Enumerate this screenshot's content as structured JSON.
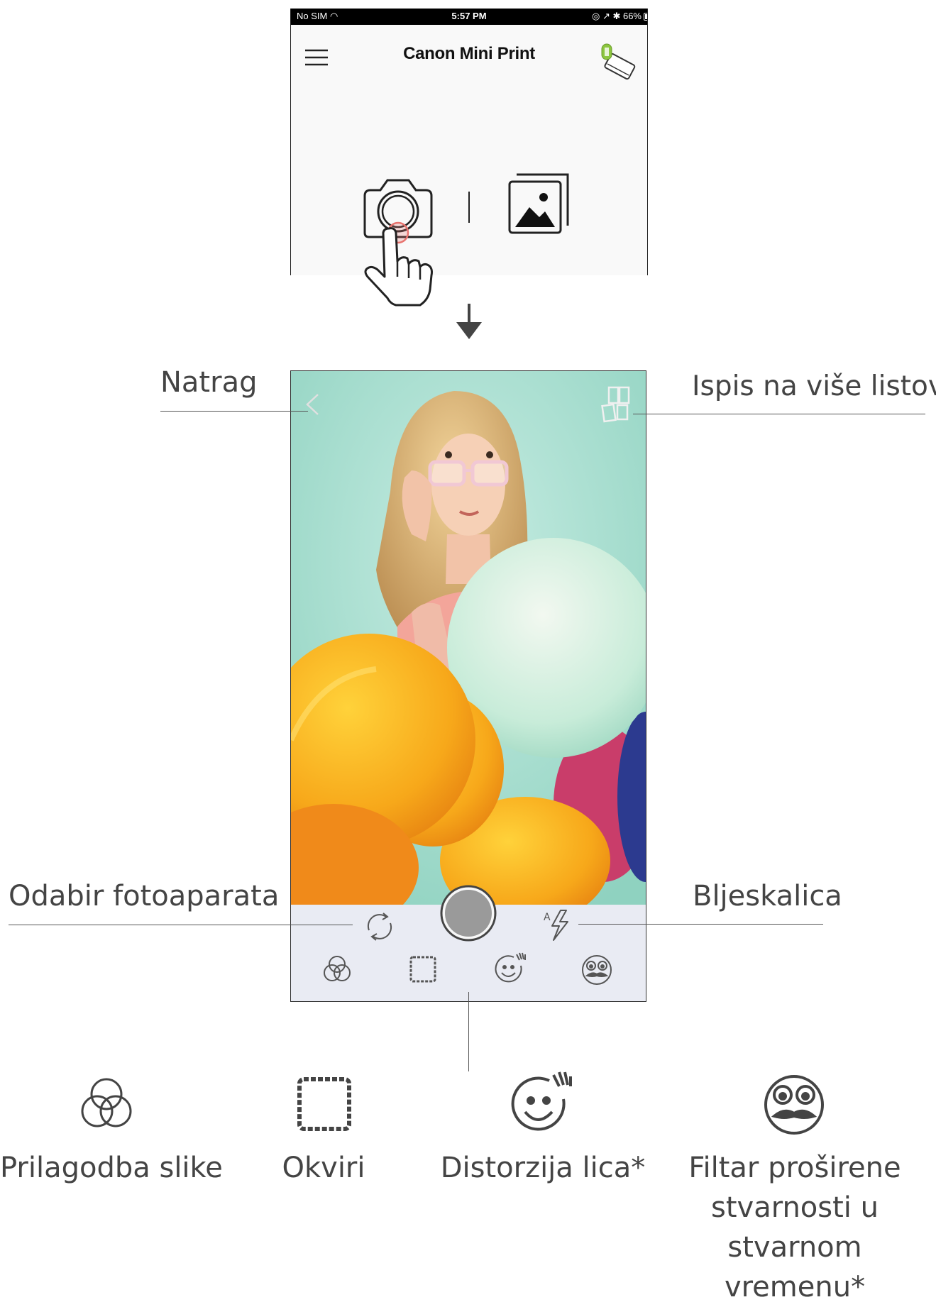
{
  "status_bar": {
    "carrier": "No SIM",
    "time": "5:57 PM",
    "battery": "66%"
  },
  "app": {
    "title": "Canon Mini Print"
  },
  "callouts": {
    "back": "Natrag",
    "multi_print": "Ispis na više listova",
    "camera_select": "Odabir fotoaparata",
    "flash": "Bljeskalica"
  },
  "legend": {
    "adjust": "Prilagodba slike",
    "frames": "Okviri",
    "face_distort": "Distorzija lica*",
    "ar_filter": "Filtar proširene stvarnosti u stvarnom vremenu*"
  },
  "icons": [
    "menu-icon",
    "printer-icon",
    "camera-icon",
    "gallery-icon",
    "hand-pointer-icon",
    "down-arrow-icon",
    "back-chevron-icon",
    "multi-print-icon",
    "shutter-button",
    "camera-flip-icon",
    "auto-flash-icon",
    "adjust-icon",
    "frames-icon",
    "face-distort-icon",
    "ar-filter-icon"
  ],
  "colors": {
    "printer_battery": "#8cc63f",
    "touch_highlight": "#e8736e",
    "bottom_bar": "#e9ebf3",
    "photo_background": "#a8dccd"
  }
}
